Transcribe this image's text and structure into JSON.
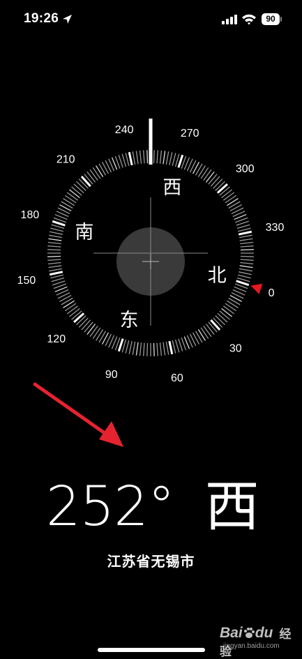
{
  "status_bar": {
    "time": "19:26",
    "battery": "90",
    "icons": [
      "location-arrow-icon",
      "cellular-signal-icon",
      "wifi-icon",
      "battery-icon"
    ]
  },
  "compass": {
    "heading_deg": 252,
    "dial_labels": [
      "0",
      "30",
      "60",
      "90",
      "120",
      "150",
      "180",
      "210",
      "240",
      "270",
      "300",
      "330"
    ],
    "cardinals": {
      "north": "北",
      "east": "东",
      "south": "南",
      "west": "西"
    },
    "north_marker_color": "#e8181e"
  },
  "readout": {
    "degrees": "252°",
    "direction": "西",
    "location": "江苏省无锡市"
  },
  "annotation": {
    "arrow_color": "#e52330"
  },
  "watermark": {
    "logo": "Bai",
    "logo_suffix": "du",
    "text": "经验",
    "url": "jingyan.baidu.com"
  }
}
